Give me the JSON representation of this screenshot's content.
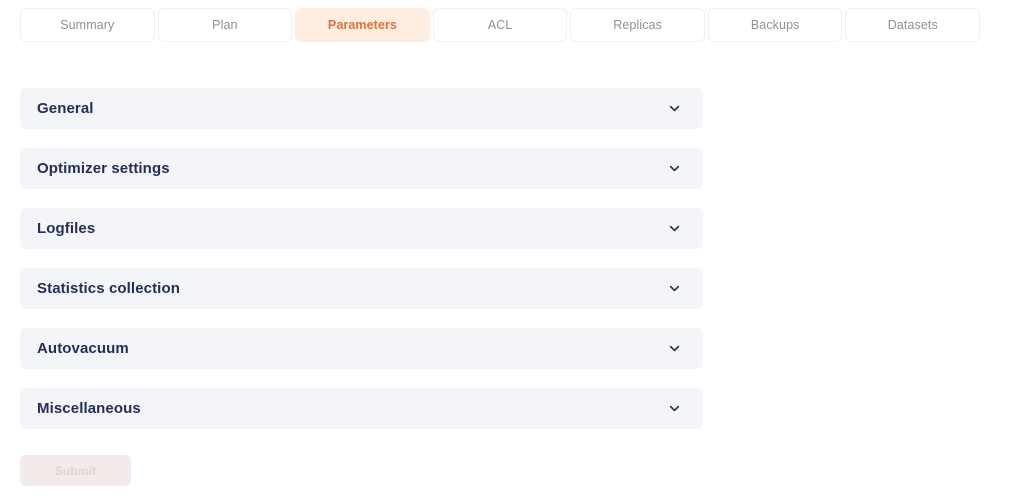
{
  "tabs": [
    {
      "label": "Summary",
      "active": false
    },
    {
      "label": "Plan",
      "active": false
    },
    {
      "label": "Parameters",
      "active": true
    },
    {
      "label": "ACL",
      "active": false
    },
    {
      "label": "Replicas",
      "active": false
    },
    {
      "label": "Backups",
      "active": false
    },
    {
      "label": "Datasets",
      "active": false
    }
  ],
  "panels": [
    {
      "title": "General",
      "icon": "chevron-down-icon",
      "expanded": false
    },
    {
      "title": "Optimizer settings",
      "icon": "chevron-down-icon",
      "expanded": false
    },
    {
      "title": "Logfiles",
      "icon": "chevron-down-icon",
      "expanded": false
    },
    {
      "title": "Statistics collection",
      "icon": "chevron-down-icon",
      "expanded": false
    },
    {
      "title": "Autovacuum",
      "icon": "chevron-down-icon",
      "expanded": false
    },
    {
      "title": "Miscellaneous",
      "icon": "chevron-down-icon",
      "expanded": false
    }
  ],
  "submit": {
    "label": "Submit",
    "disabled": true
  },
  "colors": {
    "page_background": "#ffffff",
    "panel_background": "#f4f5f8",
    "panel_title": "#242f57",
    "tab_inactive_text": "#8d9196",
    "tab_active_text": "#e0723a",
    "tab_active_background": "#fdeee1",
    "tab_border": "#f0f0f2",
    "submit_background": "#f2ebe9",
    "submit_text": "#dfd4d1"
  }
}
